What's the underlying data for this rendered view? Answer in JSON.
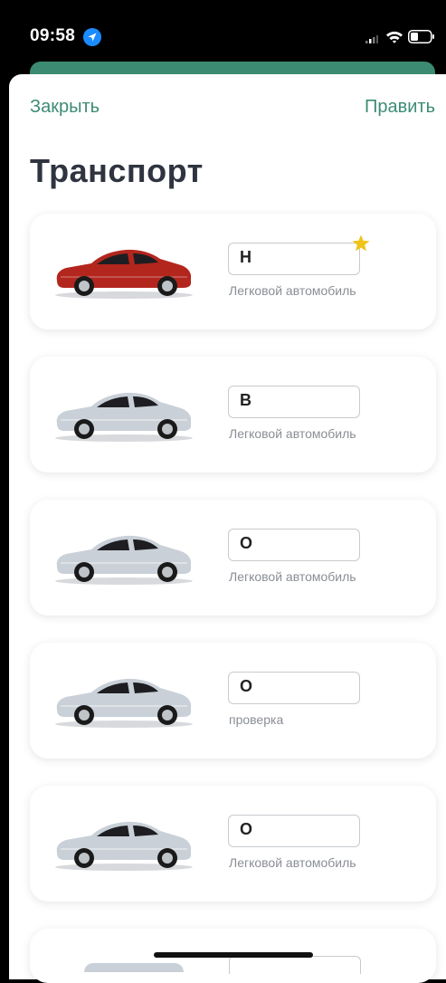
{
  "status_bar": {
    "time": "09:58",
    "icons": [
      "location-arrow-icon",
      "signal-icon",
      "wifi-icon",
      "battery-icon"
    ]
  },
  "nav": {
    "close_label": "Закрыть",
    "edit_label": "Править"
  },
  "page": {
    "title": "Транспорт"
  },
  "colors": {
    "accent": "#3e8c75",
    "title": "#2f3440",
    "muted": "#8a8e94",
    "star": "#f0c419",
    "car_red": "#b3261e",
    "car_silver": "#c9d0d8"
  },
  "vehicles": [
    {
      "plate": "Н",
      "type": "Легковой автомобиль",
      "color": "red",
      "favorite": true
    },
    {
      "plate": "В",
      "type": "Легковой автомобиль",
      "color": "silver",
      "favorite": false
    },
    {
      "plate": "О",
      "type": "Легковой автомобиль",
      "color": "silver",
      "favorite": false
    },
    {
      "plate": "О",
      "type": "проверка",
      "color": "silver",
      "favorite": false
    },
    {
      "plate": "О",
      "type": "Легковой автомобиль",
      "color": "silver",
      "favorite": false
    }
  ]
}
